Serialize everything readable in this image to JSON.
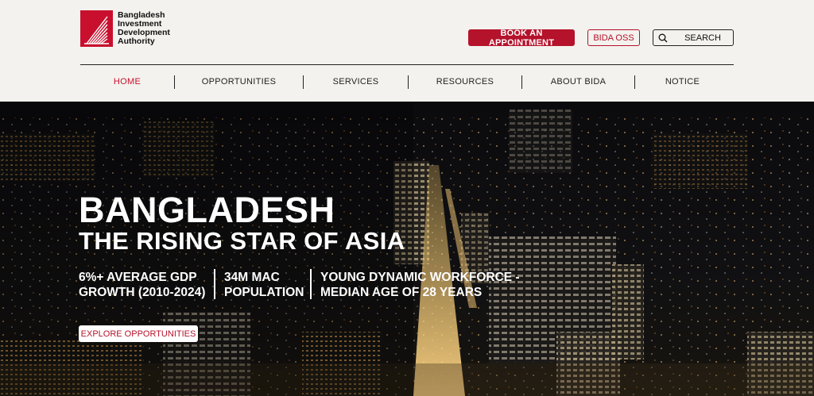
{
  "logo": {
    "line1": "Bangladesh",
    "line2": "Investment",
    "line3": "Development",
    "line4": "Authority",
    "icon": "bida-logo-icon"
  },
  "header": {
    "appointment_label": "BOOK AN APPOINTMENT",
    "oss_label": "BIDA OSS",
    "search_label": "SEARCH",
    "search_icon": "search-icon"
  },
  "nav": {
    "items": [
      {
        "label": "HOME",
        "active": true
      },
      {
        "label": "OPPORTUNITIES",
        "active": false
      },
      {
        "label": "SERVICES",
        "active": false
      },
      {
        "label": "RESOURCES",
        "active": false
      },
      {
        "label": "ABOUT BIDA",
        "active": false
      },
      {
        "label": "NOTICE",
        "active": false
      }
    ]
  },
  "hero": {
    "title": "BANGLADESH",
    "subtitle": "THE RISING STAR OF ASIA",
    "stats": [
      {
        "line1": "6%+ AVERAGE GDP",
        "line2": "GROWTH (2010-2024)"
      },
      {
        "line1": "34M MAC",
        "line2": "POPULATION"
      },
      {
        "line1": "YOUNG DYNAMIC WORKFORCE -",
        "line2": "MEDIAN AGE OF 28 YEARS"
      }
    ],
    "cta_label": "EXPLORE OPPORTUNITIES"
  },
  "colors": {
    "brand_red": "#b5122b",
    "header_bg": "#f3f2ee"
  }
}
